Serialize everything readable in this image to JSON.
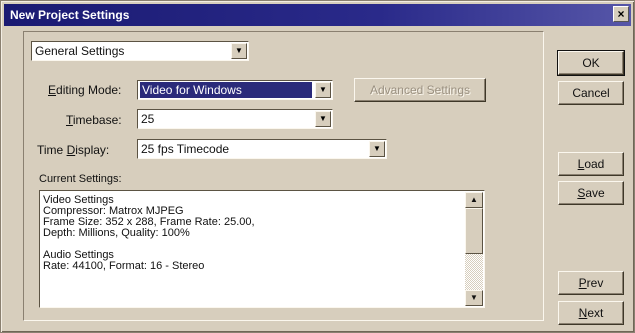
{
  "window": {
    "title": "New Project Settings",
    "close_glyph": "×"
  },
  "category": {
    "selected": "General Settings"
  },
  "editing_mode": {
    "label_prefix": "E",
    "label_rest": "diting Mode:",
    "value": "Video for Windows"
  },
  "advanced_button": {
    "label": "Advanced Settings"
  },
  "timebase": {
    "label_prefix": "T",
    "label_rest": "imebase:",
    "value": "25"
  },
  "time_display": {
    "label_pre": "Time ",
    "label_u": "D",
    "label_rest": "isplay:",
    "value": "25 fps Timecode"
  },
  "current_settings": {
    "label": "Current Settings:",
    "lines": [
      "Video Settings",
      "Compressor: Matrox MJPEG",
      "Frame Size: 352 x 288, Frame Rate: 25.00,",
      "Depth: Millions, Quality: 100%",
      "",
      "Audio Settings",
      "Rate: 44100, Format: 16 - Stereo"
    ]
  },
  "buttons": {
    "ok": "OK",
    "cancel": "Cancel",
    "load_u": "L",
    "load_rest": "oad",
    "save_u": "S",
    "save_rest": "ave",
    "prev_u": "P",
    "prev_rest": "rev",
    "next_u": "N",
    "next_rest": "ext"
  },
  "icons": {
    "dropdown": "▼",
    "scroll_up": "▲",
    "scroll_down": "▼"
  },
  "colors": {
    "title_bar": "#1a1a72",
    "selection": "#2a2a7a",
    "dialog_face": "#d7cebd"
  }
}
